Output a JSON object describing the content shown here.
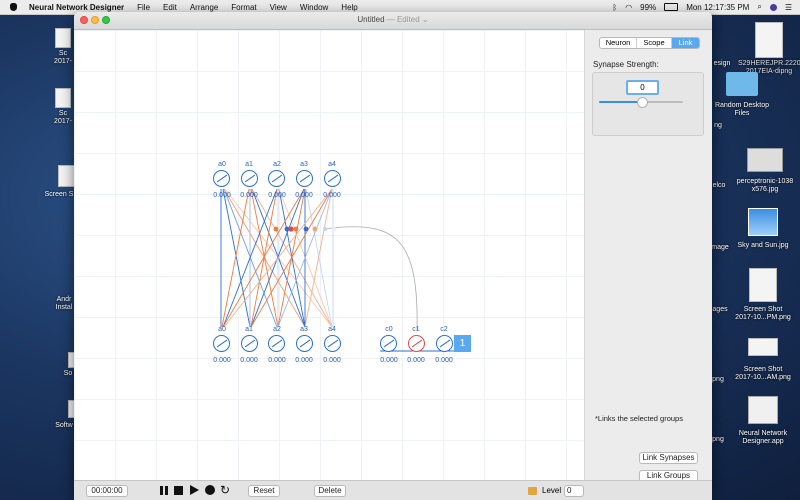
{
  "menubar": {
    "app_name": "Neural Network Designer",
    "menus": [
      "File",
      "Edit",
      "Arrange",
      "Format",
      "View",
      "Window",
      "Help"
    ],
    "battery": "99%",
    "clock": "Mon 12:17:35 PM"
  },
  "desktop": {
    "left_labels": [
      "Sc\n2017-",
      "Sc\n2017-",
      "Screen S",
      "Andr\nInstal",
      "So",
      "Softw"
    ],
    "right_items": [
      {
        "label": "esign"
      },
      {
        "label": "S29HEREJPR.2220\n2017EIA-dipng"
      },
      {
        "label": "Random Desktop\nFiles"
      },
      {
        "label": "ng"
      },
      {
        "label": "elco"
      },
      {
        "label": "perceptronic-1038\nx576.jpg"
      },
      {
        "label": "mage"
      },
      {
        "label": "Sky and Sun.jpg"
      },
      {
        "label": "ages"
      },
      {
        "label": "Screen Shot\n2017-10...PM.png"
      },
      {
        "label": "png"
      },
      {
        "label": "Screen Shot\n2017-10...AM.png"
      },
      {
        "label": "png"
      },
      {
        "label": "Neural Network\nDesigner.app"
      }
    ]
  },
  "window": {
    "title": "Untitled",
    "edited": "— Edited",
    "chevron": "⌄"
  },
  "network": {
    "layer_a": {
      "labels": [
        "a0",
        "a1",
        "a2",
        "a3",
        "a4"
      ],
      "values": [
        "0.000",
        "0.000",
        "0.000",
        "0.000",
        "0.000"
      ]
    },
    "layer_b": {
      "labels": [
        "a0",
        "a1",
        "a2",
        "a3",
        "a4"
      ],
      "values": [
        "0.000",
        "0.000",
        "0.000",
        "0.000",
        "0.000"
      ]
    },
    "layer_c": {
      "labels": [
        "c0",
        "c1",
        "c2"
      ],
      "values": [
        "0.000",
        "0.000",
        "0.000"
      ]
    },
    "badge": "1"
  },
  "inspector": {
    "tabs": [
      "Neuron",
      "Scope",
      "Link"
    ],
    "active_tab": "Link",
    "synapse_label": "Synapse Strength:",
    "synapse_value": "0",
    "slider_level": 0.5,
    "note": "*Links the selected groups",
    "link_synapses": "Link Synapses",
    "link_groups": "Link Groups"
  },
  "bottombar": {
    "time": "00:00:00",
    "reset": "Reset",
    "delete": "Delete",
    "level_label": "Level",
    "level_value": "0"
  },
  "colors": {
    "neuron_blue": "#2a6fd6",
    "selected_red": "#e24a4a",
    "accent": "#5aa9f0",
    "link_orange": "#f07a3a"
  }
}
